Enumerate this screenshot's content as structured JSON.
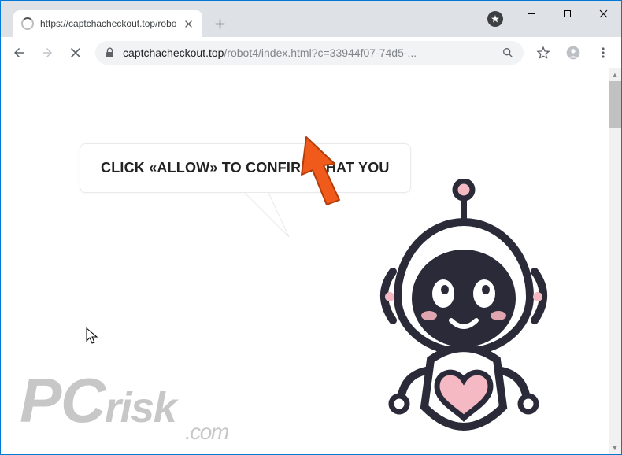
{
  "window": {
    "tab_title": "https://captchacheckout.top/robo",
    "url_host": "captchacheckout.top",
    "url_path": "/robot4/index.html?c=33944f07-74d5-..."
  },
  "page": {
    "bubble_text": "CLICK «ALLOW» TO CONFIRM THAT YOU"
  },
  "watermark": {
    "brand": "PCrisk",
    "domain": ".com"
  },
  "icons": {
    "close": "✕",
    "plus": "+",
    "minimize": "—",
    "maximize": "☐",
    "win_close": "✕",
    "menu": "⋮",
    "star": "☆",
    "profile": "👤",
    "down": "▾"
  },
  "colors": {
    "arrow": "#f05a1a",
    "robot_outline": "#2b2a38",
    "robot_pink": "#f4b9c3",
    "robot_darkpink": "#e0a6b0"
  }
}
